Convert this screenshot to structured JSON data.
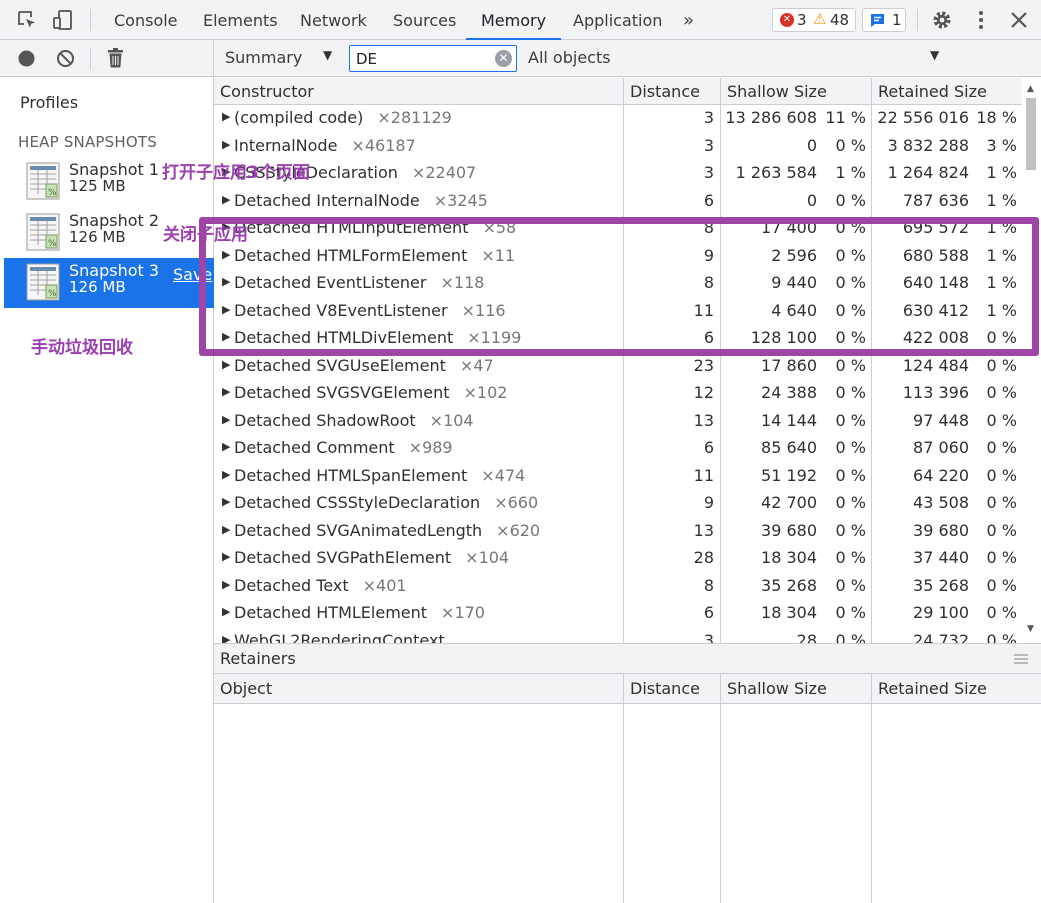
{
  "topbar": {
    "tabs": [
      "Console",
      "Elements",
      "Network",
      "Sources",
      "Memory",
      "Application"
    ],
    "active_tab": "Memory",
    "more_tabs": "»",
    "errors_count": "3",
    "warnings_count": "48",
    "messages_count": "1"
  },
  "toolbar": {
    "view_select": "Summary",
    "filter_value": "DE",
    "objects_select": "All objects"
  },
  "sidebar": {
    "profiles_label": "Profiles",
    "section_label": "HEAP SNAPSHOTS",
    "snapshots": [
      {
        "name": "Snapshot 1",
        "size": "125 MB"
      },
      {
        "name": "Snapshot 2",
        "size": "126 MB"
      },
      {
        "name": "Snapshot 3",
        "size": "126 MB",
        "save": "Save"
      }
    ],
    "selected_snapshot": "Snapshot 3"
  },
  "table": {
    "columns": [
      "Constructor",
      "Distance",
      "Shallow Size",
      "Retained Size"
    ],
    "rows": [
      {
        "name": "(compiled code)",
        "count": "×281129",
        "distance": "3",
        "shallow": "13 286 608",
        "shallow_pct": "11 %",
        "retained": "22 556 016",
        "retained_pct": "18 %"
      },
      {
        "name": "InternalNode",
        "count": "×46187",
        "distance": "3",
        "shallow": "0",
        "shallow_pct": "0 %",
        "retained": "3 832 288",
        "retained_pct": "3 %"
      },
      {
        "name": "CSSStyleDeclaration",
        "count": "×22407",
        "distance": "3",
        "shallow": "1 263 584",
        "shallow_pct": "1 %",
        "retained": "1 264 824",
        "retained_pct": "1 %"
      },
      {
        "name": "Detached InternalNode",
        "count": "×3245",
        "distance": "6",
        "shallow": "0",
        "shallow_pct": "0 %",
        "retained": "787 636",
        "retained_pct": "1 %"
      },
      {
        "name": "Detached HTMLInputElement",
        "count": "×58",
        "distance": "8",
        "shallow": "17 400",
        "shallow_pct": "0 %",
        "retained": "695 572",
        "retained_pct": "1 %"
      },
      {
        "name": "Detached HTMLFormElement",
        "count": "×11",
        "distance": "9",
        "shallow": "2 596",
        "shallow_pct": "0 %",
        "retained": "680 588",
        "retained_pct": "1 %"
      },
      {
        "name": "Detached EventListener",
        "count": "×118",
        "distance": "8",
        "shallow": "9 440",
        "shallow_pct": "0 %",
        "retained": "640 148",
        "retained_pct": "1 %"
      },
      {
        "name": "Detached V8EventListener",
        "count": "×116",
        "distance": "11",
        "shallow": "4 640",
        "shallow_pct": "0 %",
        "retained": "630 412",
        "retained_pct": "1 %"
      },
      {
        "name": "Detached HTMLDivElement",
        "count": "×1199",
        "distance": "6",
        "shallow": "128 100",
        "shallow_pct": "0 %",
        "retained": "422 008",
        "retained_pct": "0 %"
      },
      {
        "name": "Detached SVGUseElement",
        "count": "×47",
        "distance": "23",
        "shallow": "17 860",
        "shallow_pct": "0 %",
        "retained": "124 484",
        "retained_pct": "0 %"
      },
      {
        "name": "Detached SVGSVGElement",
        "count": "×102",
        "distance": "12",
        "shallow": "24 388",
        "shallow_pct": "0 %",
        "retained": "113 396",
        "retained_pct": "0 %"
      },
      {
        "name": "Detached ShadowRoot",
        "count": "×104",
        "distance": "13",
        "shallow": "14 144",
        "shallow_pct": "0 %",
        "retained": "97 448",
        "retained_pct": "0 %"
      },
      {
        "name": "Detached Comment",
        "count": "×989",
        "distance": "6",
        "shallow": "85 640",
        "shallow_pct": "0 %",
        "retained": "87 060",
        "retained_pct": "0 %"
      },
      {
        "name": "Detached HTMLSpanElement",
        "count": "×474",
        "distance": "11",
        "shallow": "51 192",
        "shallow_pct": "0 %",
        "retained": "64 220",
        "retained_pct": "0 %"
      },
      {
        "name": "Detached CSSStyleDeclaration",
        "count": "×660",
        "distance": "9",
        "shallow": "42 700",
        "shallow_pct": "0 %",
        "retained": "43 508",
        "retained_pct": "0 %"
      },
      {
        "name": "Detached SVGAnimatedLength",
        "count": "×620",
        "distance": "13",
        "shallow": "39 680",
        "shallow_pct": "0 %",
        "retained": "39 680",
        "retained_pct": "0 %"
      },
      {
        "name": "Detached SVGPathElement",
        "count": "×104",
        "distance": "28",
        "shallow": "18 304",
        "shallow_pct": "0 %",
        "retained": "37 440",
        "retained_pct": "0 %"
      },
      {
        "name": "Detached Text",
        "count": "×401",
        "distance": "8",
        "shallow": "35 268",
        "shallow_pct": "0 %",
        "retained": "35 268",
        "retained_pct": "0 %"
      },
      {
        "name": "Detached HTMLElement",
        "count": "×170",
        "distance": "6",
        "shallow": "18 304",
        "shallow_pct": "0 %",
        "retained": "29 100",
        "retained_pct": "0 %"
      },
      {
        "name": "WebGL2RenderingContext",
        "count": "",
        "distance": "3",
        "shallow": "28",
        "shallow_pct": "0 %",
        "retained": "24 732",
        "retained_pct": "0 %"
      }
    ]
  },
  "retainers": {
    "title": "Retainers",
    "columns": [
      "Object",
      "Distance",
      "Shallow Size",
      "Retained Size"
    ]
  },
  "annotations": {
    "open_app": "打开子应用3个页面",
    "close_app": "关闭子应用",
    "gc": "手动垃圾回收",
    "highlight_color": "#9e45a6"
  },
  "colors": {
    "accent": "#1a73e8",
    "error": "#d93025",
    "warning": "#f29900"
  }
}
